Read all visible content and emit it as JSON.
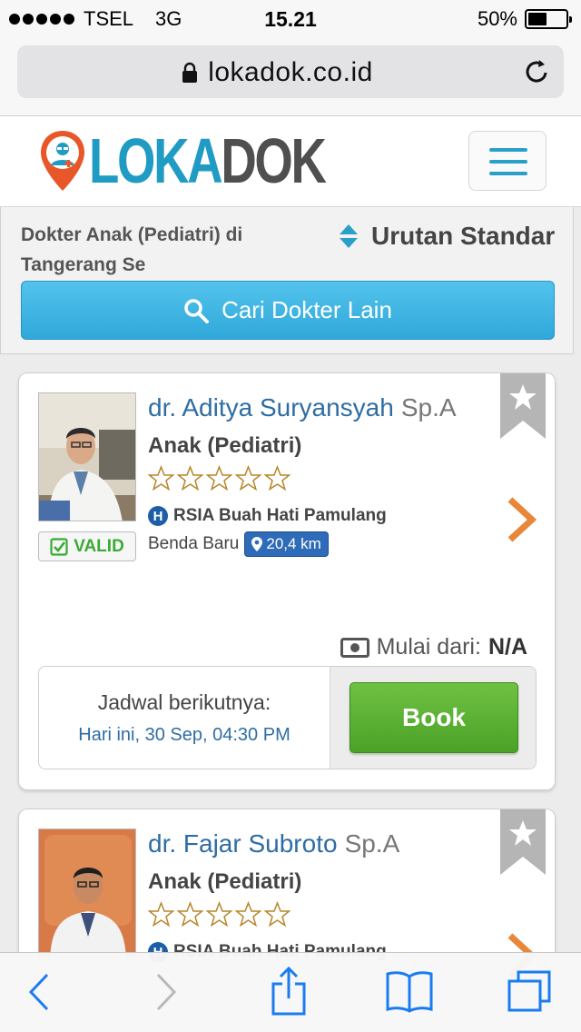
{
  "status_bar": {
    "carrier": "TSEL",
    "network": "3G",
    "time": "15.21",
    "battery": "50%",
    "battery_level": 0.5
  },
  "browser": {
    "url": "lokadok.co.id"
  },
  "header": {
    "logo_part1": "LOKA",
    "logo_part2": "DOK",
    "colors": {
      "brand_blue": "#1f9bc4",
      "brand_gray": "#4f4f4f",
      "pin_orange": "#e8572a"
    }
  },
  "search": {
    "title": "Dokter Anak (Pediatri) di Tangerang Se",
    "sort_label": "Urutan Standar",
    "search_button": "Cari Dokter Lain"
  },
  "doctors": [
    {
      "name": "dr. Aditya Suryansyah",
      "title": "Sp.A",
      "specialty": "Anak (Pediatri)",
      "rating": 0,
      "hospital": "RSIA Buah Hati Pamulang",
      "area": "Benda Baru",
      "distance": "20,4 km",
      "badge": "VALID",
      "price_label": "Mulai dari:",
      "price_value": "N/A",
      "schedule_label": "Jadwal berikutnya:",
      "schedule_value": "Hari ini, 30 Sep, 04:30 PM",
      "book_label": "Book"
    },
    {
      "name": "dr. Fajar Subroto",
      "title": "Sp.A",
      "specialty": "Anak (Pediatri)",
      "rating": 0,
      "hospital": "RSIA Buah Hati Pamulang"
    }
  ],
  "colors": {
    "link_blue": "#2e6da4",
    "search_button": "#3bb3e2",
    "book_green": "#5bb234",
    "valid_green": "#3aaa35",
    "chevron_orange": "#e8873a"
  }
}
